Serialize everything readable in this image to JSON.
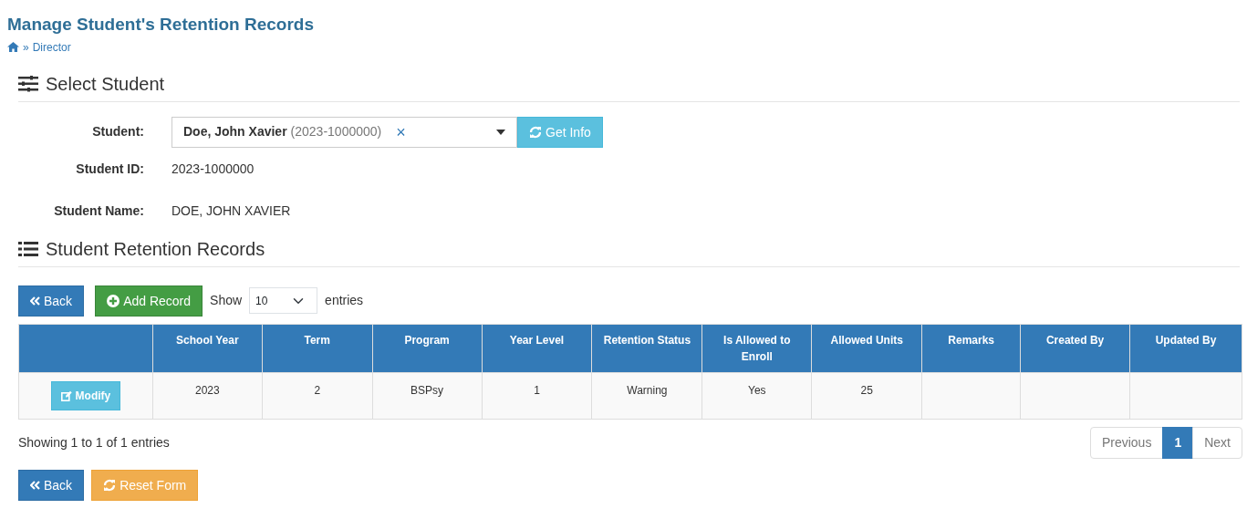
{
  "page_title": "Manage Student's Retention Records",
  "breadcrumb": {
    "separator": "»",
    "current": "Director"
  },
  "select_section": {
    "title": "Select Student"
  },
  "student_field": {
    "label": "Student:",
    "name": "Doe, John Xavier",
    "id": "(2023-1000000)",
    "clear": "×",
    "button": "Get Info"
  },
  "info": [
    {
      "label": "Student ID:",
      "value": "2023-1000000"
    },
    {
      "label": "Student Name:",
      "value": "DOE, JOHN XAVIER"
    }
  ],
  "records_section": {
    "title": "Student Retention Records"
  },
  "toolbar": {
    "back": "Back",
    "add": "Add Record",
    "show_label": "Show",
    "page_size": "10",
    "entries_label": "entries"
  },
  "table": {
    "columns": [
      "School Year",
      "Term",
      "Program",
      "Year Level",
      "Retention Status",
      "Is Allowed to Enroll",
      "Allowed Units",
      "Remarks",
      "Created By",
      "Updated By"
    ],
    "rows": [
      {
        "action": "Modify",
        "cells": [
          "2023",
          "2",
          "BSPsy",
          "1",
          "Warning",
          "Yes",
          "25"
        ]
      }
    ]
  },
  "summary": "Showing 1 to 1 of 1 entries",
  "pagination": {
    "previous": {
      "label": "Previous",
      "disabled": true
    },
    "pages": [
      {
        "label": "1",
        "selected": true
      }
    ],
    "next": {
      "label": "Next",
      "disabled": true
    }
  },
  "footer_buttons": [
    {
      "kind": "back",
      "label": "Back"
    },
    {
      "kind": "reset",
      "label": "Reset Form"
    }
  ]
}
